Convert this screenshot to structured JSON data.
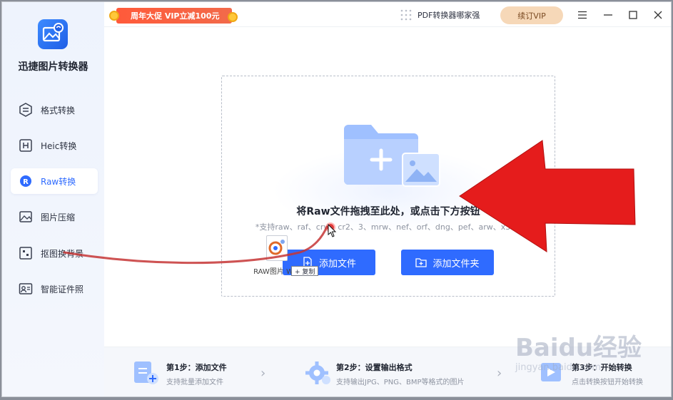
{
  "app": {
    "name": "迅捷图片转换器"
  },
  "sidebar": {
    "items": [
      {
        "label": "格式转换",
        "icon": "format-convert-icon"
      },
      {
        "label": "Heic转换",
        "icon": "heic-icon"
      },
      {
        "label": "Raw转换",
        "icon": "raw-icon",
        "active": true
      },
      {
        "label": "图片压缩",
        "icon": "image-compress-icon"
      },
      {
        "label": "抠图换背景",
        "icon": "cutout-icon"
      },
      {
        "label": "智能证件照",
        "icon": "id-photo-icon"
      }
    ]
  },
  "topbar": {
    "promo": "周年大促 VIP立减100元",
    "pdf_label": "PDF转换器哪家强",
    "vip_button": "续订VIP",
    "controls": [
      "menu-icon",
      "minimize-icon",
      "maximize-icon",
      "close-icon"
    ]
  },
  "dropzone": {
    "title": "将Raw文件拖拽至此处，或点击下方按钮",
    "subtitle": "*支持raw、raf、crw、cr2、3、mrw、nef、orf、dng、pef、arw、x3f、",
    "add_file_button": "添加文件",
    "add_folder_button": "添加文件夹"
  },
  "drag": {
    "file_label": "RAW图片 W",
    "copy_label": "+ 复制"
  },
  "steps": [
    {
      "title": "第1步：添加文件",
      "desc": "支持批量添加文件"
    },
    {
      "title": "第2步：设置输出格式",
      "desc": "支持输出JPG、PNG、BMP等格式的图片"
    },
    {
      "title": "第3步：开始转换",
      "desc": "点击转换按钮开始转换"
    }
  ],
  "watermark": {
    "text": "Baidu经验",
    "sub": "jingyan.baidu.com"
  },
  "colors": {
    "accent": "#2f6bff",
    "promo": "#ff5a3a",
    "vip": "#f6d8b8",
    "arrow": "#e51c1c"
  }
}
